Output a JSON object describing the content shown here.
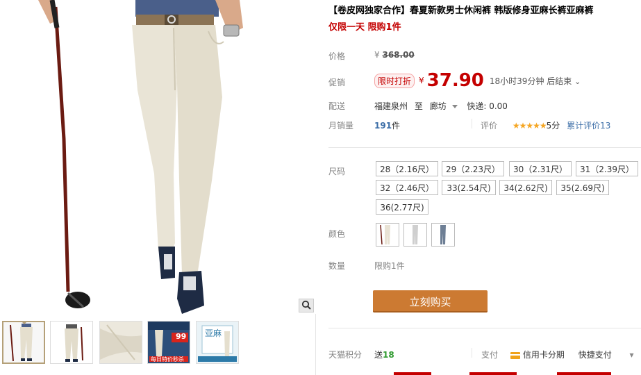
{
  "product": {
    "title": "【卷皮网独家合作】春夏新款男士休闲裤 韩版修身亚麻长裤亚麻裤",
    "subtitle": "仅限一天 限购1件"
  },
  "price": {
    "label": "价格",
    "yen": "¥",
    "original": "368.00",
    "promo_label": "促销",
    "promo_tag": "限时打折",
    "current": "37.90",
    "countdown": "18小时39分钟 后结束",
    "countdown_arrow": "⌄"
  },
  "shipping": {
    "label": "配送",
    "from": "福建泉州",
    "to_word": "至",
    "to": "廊坊",
    "express": "快递: 0.00"
  },
  "sales": {
    "label": "月销量",
    "count": "191",
    "unit": "件",
    "rating_label": "评价",
    "stars": "★★★★★",
    "score": "5分",
    "total_reviews": "累计评价13"
  },
  "size": {
    "label": "尺码",
    "options": [
      "28（2.16尺）",
      "29（2.23尺）",
      "30（2.31尺）",
      "31（2.39尺）",
      "32（2.46尺）",
      "33(2.54尺)",
      "34(2.62尺)",
      "35(2.69尺)",
      "36(2.77尺)"
    ]
  },
  "color": {
    "label": "颜色",
    "swatches": [
      "#e8e2d4",
      "#d9d9d9",
      "#6e7f95"
    ]
  },
  "quantity": {
    "label": "数量",
    "limit": "限购1件"
  },
  "buy_button": "立刻购买",
  "points": {
    "label": "天猫积分",
    "send": "送",
    "value": "18",
    "pay_label": "支付",
    "credit": "信用卡分期",
    "quick": "快捷支付",
    "more_arrow": "▾"
  },
  "thumb_badges": {
    "badge4_num": "99",
    "badge4_text": "每日特价秒杀",
    "badge5_title": "亚麻"
  },
  "colors": {
    "accent_red": "#c40000",
    "buy_orange": "#cc7a32",
    "link_blue": "#3c6ea7"
  }
}
